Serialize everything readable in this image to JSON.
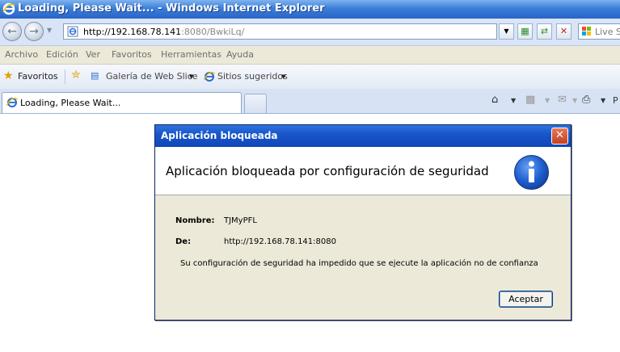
{
  "window": {
    "title": "Loading, Please Wait... - Windows Internet Explorer"
  },
  "address": {
    "url_host": "http://192.168.78.141",
    "url_rest": ":8080/BwkiLq/",
    "search_placeholder": "Live S"
  },
  "menu": [
    "Archivo",
    "Edición",
    "Ver",
    "Favoritos",
    "Herramientas",
    "Ayuda"
  ],
  "favorites": {
    "favorites_label": "Favoritos",
    "webslice_label": "Galería de Web Slice",
    "suggested_label": "Sitios sugeridos"
  },
  "tabs": {
    "active_label": "Loading, Please Wait..."
  },
  "toolbar": {
    "page_label": "P"
  },
  "dialog": {
    "title": "Aplicación bloqueada",
    "heading": "Aplicación bloqueada por configuración de seguridad",
    "name_label": "Nombre:",
    "name_value": "TJMyPFL",
    "from_label": "De:",
    "from_value": "http://192.168.78.141:8080",
    "message": "Su configuración de seguridad ha impedido que se ejecute la aplicación no de confianza",
    "ok_label": "Aceptar"
  },
  "colors": {
    "titlebar": "#2a63c7",
    "dialog_title": "#0f47b8",
    "dialog_body": "#ece9d8"
  }
}
